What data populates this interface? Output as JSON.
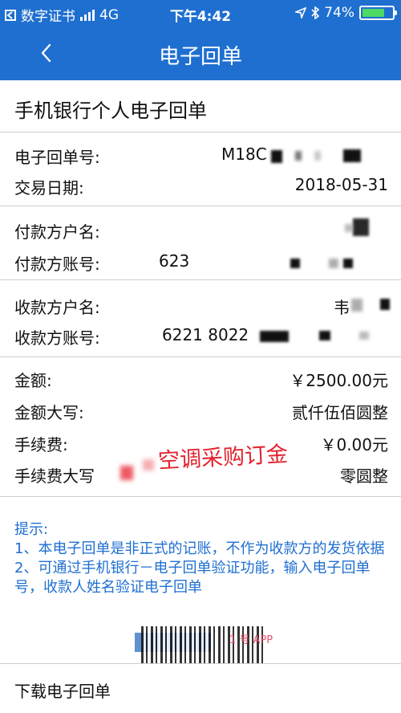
{
  "status_bar": {
    "carrier_app": "数字证书",
    "network": "4G",
    "time": "下午4:42",
    "battery": "74%",
    "battery_level": 0.74,
    "icons": [
      "back-to-app-icon",
      "signal-icon",
      "location-icon",
      "bluetooth-icon",
      "battery-icon"
    ]
  },
  "nav": {
    "title": "电子回单",
    "back_icon": "chevron-left-icon"
  },
  "receipt": {
    "heading": "手机银行个人电子回单",
    "receipt_no_label": "电子回单号:",
    "receipt_no_value": "M18C",
    "date_label": "交易日期:",
    "date_value": "2018-05-31",
    "payer_name_label": "付款方户名:",
    "payer_account_label": "付款方账号:",
    "payer_account_value": "623",
    "payee_name_label": "收款方户名:",
    "payee_name_value": "韦",
    "payee_account_label": "收款方账号:",
    "payee_account_value": "6221 8022",
    "amount_label": "金额:",
    "amount_value": "￥2500.00元",
    "amount_caps_label": "金额大写:",
    "amount_caps_value": "贰仟伍佰圆整",
    "fee_label": "手续费:",
    "fee_value": "￥0.00元",
    "fee_caps_label": "手续费大写",
    "fee_caps_value": "零圆整",
    "stamp_text": "空调采购订金"
  },
  "tips": {
    "title": "提示:",
    "line1": "1、本电子回单是非正式的记账，不作为收款方的发货依据",
    "line2": "2、可通过手机银行－电子回单验证功能，输入电子回单号，收款人姓名验证电子回单"
  },
  "watermark": {
    "brand": "1 号 APP"
  },
  "footer": {
    "download_label": "下载电子回单"
  },
  "colors": {
    "brand_blue": "#1f6fd0",
    "tip_blue": "#1f6fd0",
    "stamp_red": "#e3222d",
    "battery_green": "#4cd964"
  }
}
